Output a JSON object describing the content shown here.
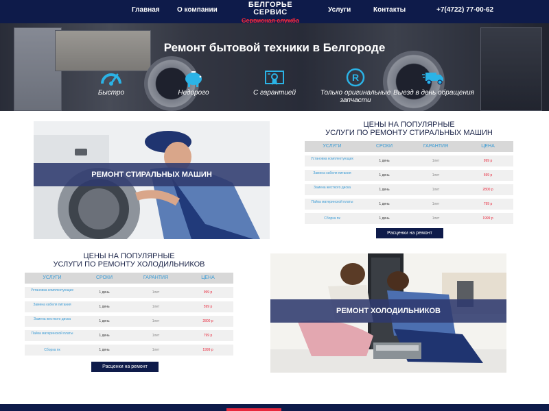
{
  "nav": {
    "home": "Главная",
    "about": "О компании",
    "services": "Услуги",
    "contacts": "Контакты",
    "phone": "+7(4722) 77-00-62"
  },
  "logo": {
    "line1": "БЕЛГОРЬЕ",
    "line2": "СЕРВИС",
    "sub": "Сервисная служба"
  },
  "hero": {
    "title": "Ремонт бытовой техники в Белгороде",
    "features": [
      {
        "icon": "speedometer-icon",
        "label": "Быстро"
      },
      {
        "icon": "piggy-bank-icon",
        "label": "Недорого"
      },
      {
        "icon": "certificate-icon",
        "label": "С гарантией"
      },
      {
        "icon": "registered-icon",
        "label": "Только оригинальные запчасти"
      },
      {
        "icon": "delivery-truck-icon",
        "label": "Выезд в день обращения"
      }
    ]
  },
  "washers": {
    "banner": "РЕМОНТ СТИРАЛЬНЫХ МАШИН",
    "title_l1": "ЦЕНЫ НА ПОПУЛЯРНЫЕ",
    "title_l2": "УСЛУГИ ПО РЕМОНТУ СТИРАЛЬНЫХ МАШИН",
    "headers": [
      "УСЛУГИ",
      "СРОКИ",
      "ГАРАНТИЯ",
      "ЦЕНА"
    ],
    "rows": [
      {
        "service": "Установка комплектующих",
        "term": "1 день",
        "warranty": "1лет",
        "price": "999 р"
      },
      {
        "service": "Замена кабеля питания",
        "term": "1 день",
        "warranty": "1лет",
        "price": "599 р"
      },
      {
        "service": "Замена жесткого диска",
        "term": "1 день",
        "warranty": "1лет",
        "price": "2800 р"
      },
      {
        "service": "Пайка материнской платы",
        "term": "1 день",
        "warranty": "1лет",
        "price": "799 р"
      },
      {
        "service": "Сборка пк",
        "term": "1 день",
        "warranty": "1лет",
        "price": "1999 р"
      }
    ],
    "button": "Расценки на ремонт"
  },
  "fridges": {
    "banner": "РЕМОНТ ХОЛОДИЛЬНИКОВ",
    "title_l1": "ЦЕНЫ НА ПОПУЛЯРНЫЕ",
    "title_l2": "УСЛУГИ ПО РЕМОНТУ ХОЛОДИЛЬНИКОВ",
    "headers": [
      "УСЛУГИ",
      "СРОКИ",
      "ГАРАНТИЯ",
      "ЦЕНА"
    ],
    "rows": [
      {
        "service": "Установка комплектующих",
        "term": "1 день",
        "warranty": "1лет",
        "price": "999 р"
      },
      {
        "service": "Замена кабеля питания",
        "term": "1 день",
        "warranty": "1лет",
        "price": "599 р"
      },
      {
        "service": "Замена жесткого диска",
        "term": "1 день",
        "warranty": "1лет",
        "price": "2800 р"
      },
      {
        "service": "Пайка материнской платы",
        "term": "1 день",
        "warranty": "1лет",
        "price": "799 р"
      },
      {
        "service": "Сборка пк",
        "term": "1 день",
        "warranty": "1лет",
        "price": "1999 р"
      }
    ],
    "button": "Расценки на ремонт"
  },
  "colors": {
    "navy": "#0e1b4a",
    "accent_red": "#e8283c",
    "link_blue": "#3a9bd5",
    "icon_cyan": "#2bb3e6"
  }
}
